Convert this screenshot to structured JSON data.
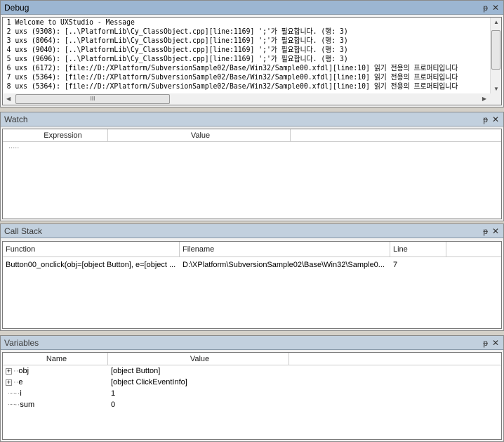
{
  "debug": {
    "title": "Debug",
    "lines": [
      "1 Welcome to UXStudio - Message",
      "2 uxs (9308): [..\\PlatformLib\\Cy_ClassObject.cpp][line:1169] ';'가 필요합니다. (행: 3)",
      "3 uxs (8064): [..\\PlatformLib\\Cy_ClassObject.cpp][line:1169] ';'가 필요합니다. (행: 3)",
      "4 uxs (9040): [..\\PlatformLib\\Cy_ClassObject.cpp][line:1169] ';'가 필요합니다. (행: 3)",
      "5 uxs (9696): [..\\PlatformLib\\Cy_ClassObject.cpp][line:1169] ';'가 필요합니다. (행: 3)",
      "6 uxs (6172): [file://D:/XPlatform/SubversionSample02/Base/Win32/Sample00.xfdl][line:10] 읽기 전용의 프로퍼티입니다",
      "7 uxs (5364): [file://D:/XPlatform/SubversionSample02/Base/Win32/Sample00.xfdl][line:10] 읽기 전용의 프로퍼티입니다",
      "8 uxs (5364): [file://D:/XPlatform/SubversionSample02/Base/Win32/Sample00.xfdl][line:10] 읽기 전용의 프로퍼티입니다"
    ]
  },
  "watch": {
    "title": "Watch",
    "columns": [
      "Expression",
      "Value"
    ],
    "placeholder": "....."
  },
  "callstack": {
    "title": "Call Stack",
    "columns": [
      "Function",
      "Filename",
      "Line"
    ],
    "rows": [
      {
        "function": "Button00_onclick(obj=[object Button], e=[object ...",
        "filename": "D:\\XPlatform\\SubversionSample02\\Base\\Win32\\Sample0...",
        "line": "7"
      }
    ]
  },
  "variables": {
    "title": "Variables",
    "columns": [
      "Name",
      "Value"
    ],
    "rows": [
      {
        "name": "obj",
        "value": "[object Button]",
        "expandable": true
      },
      {
        "name": "e",
        "value": "[object ClickEventInfo]",
        "expandable": true
      },
      {
        "name": "i",
        "value": "1",
        "expandable": false
      },
      {
        "name": "sum",
        "value": "0",
        "expandable": false
      }
    ]
  },
  "icons": {
    "pin": "⊥",
    "close": "✕"
  }
}
